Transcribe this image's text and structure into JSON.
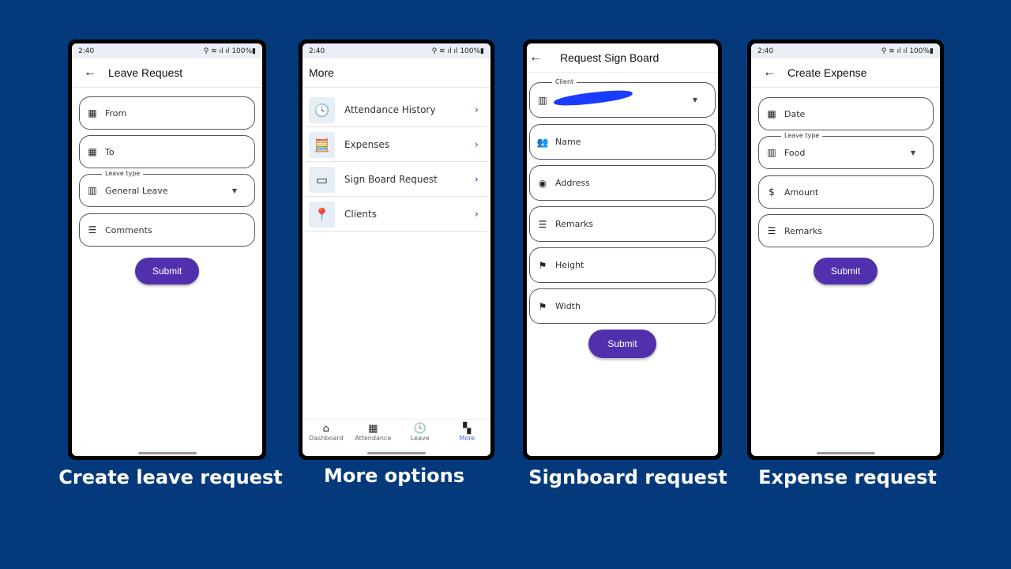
{
  "status": {
    "time": "2:40",
    "battery": "100%"
  },
  "screens": [
    {
      "title": "Leave Request",
      "caption": "Create leave request",
      "submit": "Submit",
      "fields": [
        {
          "icon": "calendar-icon",
          "label": "From"
        },
        {
          "icon": "calendar-icon",
          "label": "To"
        },
        {
          "icon": "table-icon",
          "label": "General Leave",
          "legend": "Leave type",
          "dropdown": true
        },
        {
          "icon": "notes-icon",
          "label": "Comments"
        }
      ]
    },
    {
      "title": "More",
      "caption": "More options",
      "items": [
        {
          "label": "Attendance History",
          "icon": "clock-icon"
        },
        {
          "label": "Expenses",
          "icon": "calculator-icon"
        },
        {
          "label": "Sign Board Request",
          "icon": "signboard-icon"
        },
        {
          "label": "Clients",
          "icon": "map-pins-icon"
        }
      ],
      "nav": [
        {
          "label": "Dashboard",
          "icon": "home-icon"
        },
        {
          "label": "Attendance",
          "icon": "calendar-icon"
        },
        {
          "label": "Leave",
          "icon": "clock-icon"
        },
        {
          "label": "More",
          "icon": "grid-plus-icon",
          "active": true
        }
      ]
    },
    {
      "title": "Request Sign Board",
      "caption": "Signboard request",
      "submit": "Submit",
      "fields": [
        {
          "icon": "table-icon",
          "label": "",
          "legend": "Client",
          "dropdown": true,
          "redacted": true
        },
        {
          "icon": "people-icon",
          "label": "Name"
        },
        {
          "icon": "account-icon",
          "label": "Address"
        },
        {
          "icon": "notes-icon",
          "label": "Remarks"
        },
        {
          "icon": "signpost-icon",
          "label": "Height"
        },
        {
          "icon": "signpost-icon",
          "label": "Width"
        }
      ]
    },
    {
      "title": "Create Expense",
      "caption": "Expense request",
      "submit": "Submit",
      "fields": [
        {
          "icon": "calendar-icon",
          "label": "Date"
        },
        {
          "icon": "table-icon",
          "label": "Food",
          "legend": "Leave type",
          "dropdown": true
        },
        {
          "icon": "dollar-icon",
          "label": "Amount"
        },
        {
          "icon": "notes-icon",
          "label": "Remarks"
        }
      ]
    }
  ],
  "colors": {
    "background": "#043a7c",
    "accent": "#5130ad",
    "nav_active": "#3a6ee8"
  }
}
